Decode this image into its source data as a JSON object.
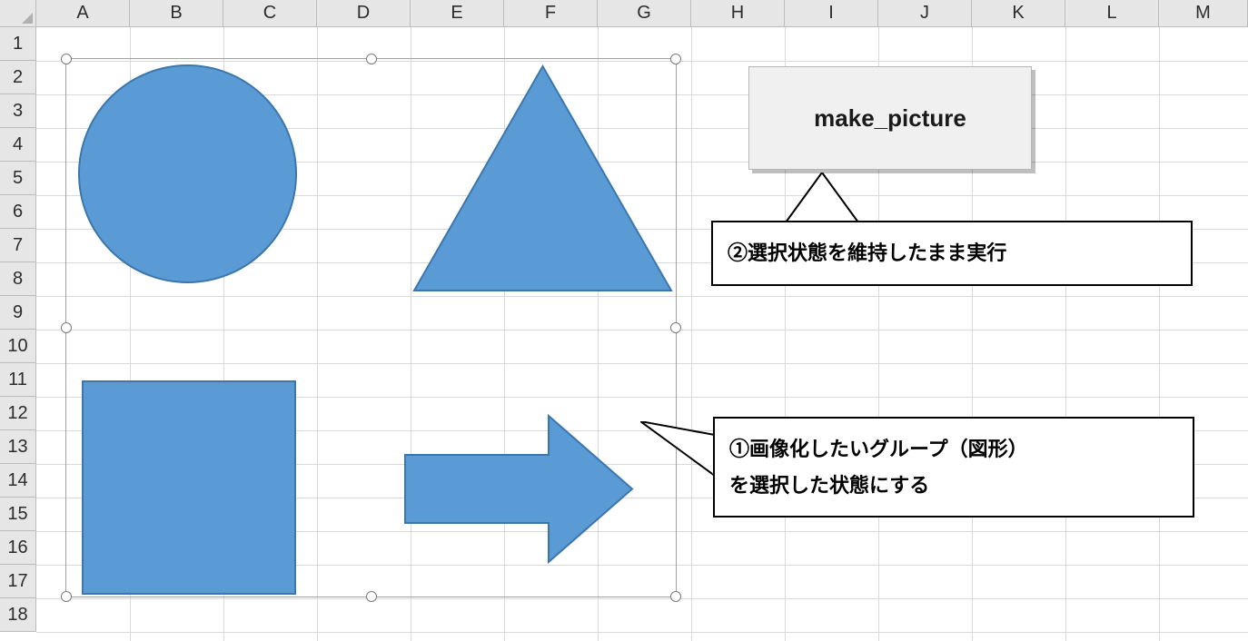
{
  "columns": [
    "A",
    "B",
    "C",
    "D",
    "E",
    "F",
    "G",
    "H",
    "I",
    "J",
    "K",
    "L",
    "M"
  ],
  "rows": [
    "1",
    "2",
    "3",
    "4",
    "5",
    "6",
    "7",
    "8",
    "9",
    "10",
    "11",
    "12",
    "13",
    "14",
    "15",
    "16",
    "17",
    "18"
  ],
  "button": {
    "label": "make_picture"
  },
  "callouts": {
    "step2": "②選択状態を維持したまま実行",
    "step1_line1": "①画像化したいグループ（図形）",
    "step1_line2": "を選択した状態にする"
  },
  "shapes": {
    "circle": "circle-shape",
    "triangle": "triangle-shape",
    "square": "square-shape",
    "arrow": "right-arrow-shape"
  },
  "colors": {
    "shapeFill": "#5b9bd5",
    "shapeStroke": "#3b76ac"
  }
}
